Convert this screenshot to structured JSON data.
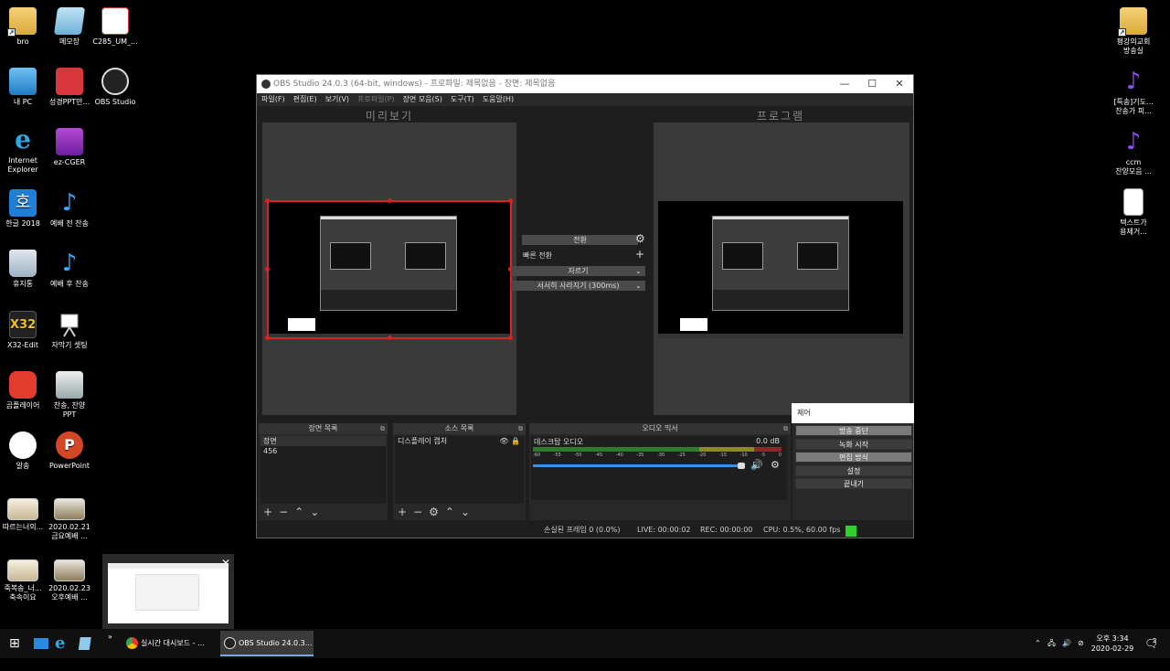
{
  "desktop": {
    "icons": [
      {
        "label": "bro",
        "icon": "folder-icon"
      },
      {
        "label": "메모장",
        "icon": "notepad-icon"
      },
      {
        "label": "C285_UM_...",
        "icon": "pdf-icon"
      },
      {
        "label": "내 PC",
        "icon": "computer-icon"
      },
      {
        "label": "성경PPT만...",
        "icon": "bible-ppt-icon"
      },
      {
        "label": "OBS Studio",
        "icon": "obs-icon"
      },
      {
        "label": "Internet",
        "label2": "Explorer",
        "icon": "ie-icon"
      },
      {
        "label": "ez-CGER",
        "icon": "ezcger-icon"
      },
      {
        "label": "한글 2018",
        "icon": "hwp-icon"
      },
      {
        "label": "예배 전 찬송",
        "icon": "music-icon"
      },
      {
        "label": "휴지통",
        "icon": "recycle-bin-icon"
      },
      {
        "label": "예배 후 찬송",
        "icon": "music-icon"
      },
      {
        "label": "X32-Edit",
        "icon": "x32-edit-icon"
      },
      {
        "label": "자막기 셋팅",
        "icon": "easel-icon"
      },
      {
        "label": "곰플레이어",
        "icon": "gom-player-icon"
      },
      {
        "label": "찬송, 찬양",
        "label2": "PPT",
        "icon": "printer-icon"
      },
      {
        "label": "알송",
        "icon": "alsong-icon"
      },
      {
        "label": "PowerPoint",
        "icon": "powerpoint-icon"
      },
      {
        "label": "따르는너의...",
        "icon": "image-thumb-icon"
      },
      {
        "label": "2020.02.21",
        "label2": "금요예배 ...",
        "icon": "image-thumb-icon"
      },
      {
        "label": "죽복송_너...",
        "label2": "축속이요",
        "icon": "image-thumb-icon"
      },
      {
        "label": "2020.02.23",
        "label2": "오후예배 ...",
        "icon": "image-thumb-icon"
      },
      {
        "label": "평강의교회",
        "label2": "방송실",
        "icon": "folder-user-icon"
      },
      {
        "label": "[특송]기도...",
        "label2": "찬송가 피...",
        "icon": "mp3-icon"
      },
      {
        "label": "ccm",
        "label2": "찬양모음 ...",
        "icon": "mp3-icon"
      },
      {
        "label": "텍스트가",
        "label2": "용제거...",
        "icon": "text-file-icon"
      }
    ]
  },
  "obs": {
    "title": "OBS Studio 24.0.3 (64-bit, windows) - 프로파일: 제목없음 - 장면: 제목없음",
    "menu": [
      "파일(F)",
      "편집(E)",
      "보기(V)",
      "프로파일(P)",
      "장면 모음(S)",
      "도구(T)",
      "도움말(H)"
    ],
    "preview_label": "미리보기",
    "program_label": "프로그램",
    "transition": {
      "button": "전환",
      "quick_label": "빠른 전환",
      "cut_label": "자르기",
      "fade_label": "서서히 사라지기 (300ms)"
    },
    "scenes": {
      "title": "장면 목록",
      "items": [
        "장면",
        "456"
      ]
    },
    "sources": {
      "title": "소스 목록",
      "items": [
        "디스플레이 캡처"
      ]
    },
    "mixer": {
      "title": "오디오 믹서",
      "channel": "데스크탑 오디오",
      "level": "0.0 dB",
      "scale": [
        "-60",
        "-55",
        "-50",
        "-45",
        "-40",
        "-35",
        "-30",
        "-25",
        "-20",
        "-15",
        "-10",
        "-5",
        "0"
      ]
    },
    "controls": {
      "title": "제어",
      "buttons": [
        "방송 중단",
        "녹화 시작",
        "편집 방식",
        "설정",
        "끝내기"
      ]
    },
    "status": {
      "dropped": "손실된 프레임 0 (0.0%)",
      "live": "LIVE: 00:00:02",
      "rec": "REC: 00:00:00",
      "cpu": "CPU: 0.5%, 60.00 fps"
    }
  },
  "taskbar": {
    "apps": [
      {
        "label": "실시간 대시보드 - ...",
        "icon": "chrome-icon"
      },
      {
        "label": "OBS Studio 24.0.3...",
        "icon": "obs-icon"
      }
    ],
    "time": "오후 3:34",
    "date": "2020-02-29",
    "notification_count": "2"
  },
  "colors": {
    "accent_red": "#d22222",
    "live_green": "#2ed22e",
    "meter_green": "#2f8f2f",
    "volume_blue": "#3a8ee6"
  }
}
